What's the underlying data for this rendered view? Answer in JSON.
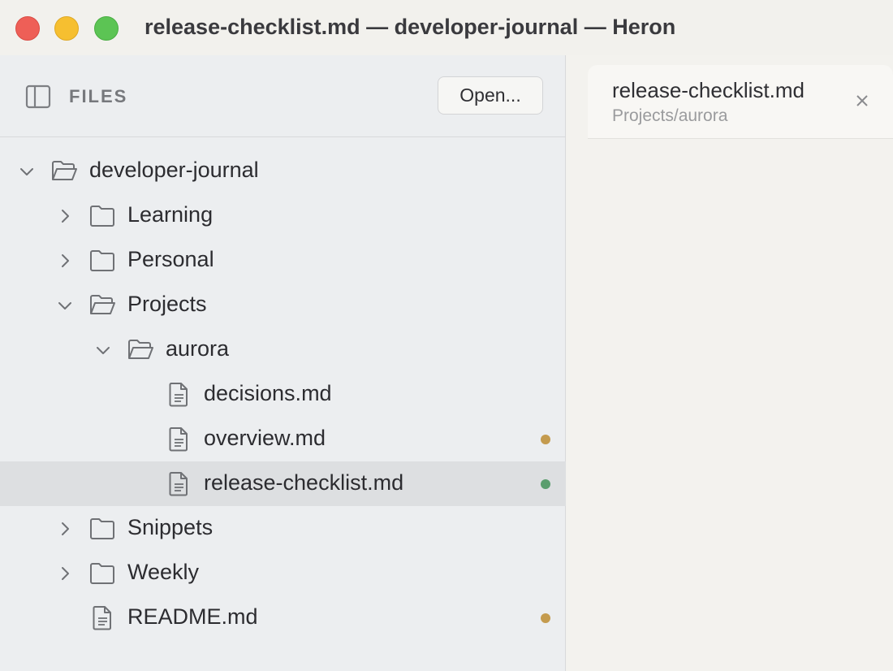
{
  "window": {
    "title": "release-checklist.md — developer-journal — Heron"
  },
  "sidebar": {
    "header_label": "FILES",
    "open_button": "Open...",
    "tree": [
      {
        "label": "developer-journal",
        "type": "folder",
        "expanded": true,
        "depth": 0
      },
      {
        "label": "Learning",
        "type": "folder",
        "expanded": false,
        "depth": 1
      },
      {
        "label": "Personal",
        "type": "folder",
        "expanded": false,
        "depth": 1
      },
      {
        "label": "Projects",
        "type": "folder",
        "expanded": true,
        "depth": 1
      },
      {
        "label": "aurora",
        "type": "folder",
        "expanded": true,
        "depth": 2
      },
      {
        "label": "decisions.md",
        "type": "file",
        "depth": 3
      },
      {
        "label": "overview.md",
        "type": "file",
        "depth": 3,
        "status": "modified",
        "status_color": "#c49b4e"
      },
      {
        "label": "release-checklist.md",
        "type": "file",
        "depth": 3,
        "selected": true,
        "status": "active",
        "status_color": "#5a9e6e"
      },
      {
        "label": "Snippets",
        "type": "folder",
        "expanded": false,
        "depth": 1
      },
      {
        "label": "Weekly",
        "type": "folder",
        "expanded": false,
        "depth": 1
      },
      {
        "label": "README.md",
        "type": "file",
        "depth": 1,
        "status": "modified",
        "status_color": "#c49b4e"
      }
    ]
  },
  "editor": {
    "tab": {
      "title": "release-checklist.md",
      "path": "Projects/aurora"
    }
  },
  "colors": {
    "traffic_red": "#ee5f57",
    "traffic_yellow": "#f6bf30",
    "traffic_green": "#5cc454",
    "selection": "#dddfe1"
  }
}
